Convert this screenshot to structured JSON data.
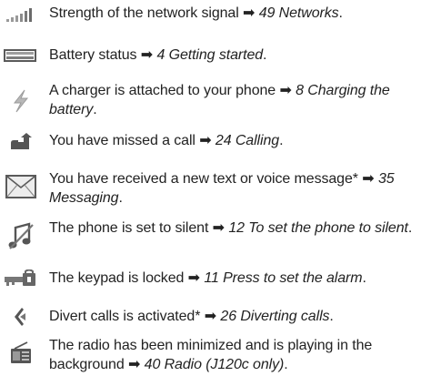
{
  "arrow_glyph": "➡",
  "items": [
    {
      "icon": "signal-strength-icon",
      "text": "Strength of the network signal",
      "ref": "49 Networks",
      "suffix": "."
    },
    {
      "icon": "battery-icon",
      "text": "Battery status",
      "ref": "4 Getting started",
      "suffix": "."
    },
    {
      "icon": "charger-icon",
      "text": "A charger is attached to your phone",
      "ref": "8 Charging the battery",
      "suffix": "."
    },
    {
      "icon": "missed-call-icon",
      "text": "You have missed a call",
      "ref": "24 Calling",
      "suffix": "."
    },
    {
      "icon": "message-envelope-icon",
      "text": "You have received a new text or voice message*",
      "ref": "35 Messaging",
      "suffix": "."
    },
    {
      "icon": "silent-icon",
      "text": "The phone is set to silent",
      "ref": "12 To set the phone to silent",
      "suffix": "."
    },
    {
      "icon": "keypad-lock-icon",
      "text": "The keypad is locked",
      "ref": "11 Press to set the alarm",
      "suffix": "."
    },
    {
      "icon": "divert-calls-icon",
      "text": "Divert calls is activated*",
      "ref": "26 Diverting calls",
      "suffix": "."
    },
    {
      "icon": "radio-icon",
      "text": "The radio has been minimized and is playing in the background",
      "ref": "40 Radio (J120c only)",
      "suffix": "."
    }
  ]
}
